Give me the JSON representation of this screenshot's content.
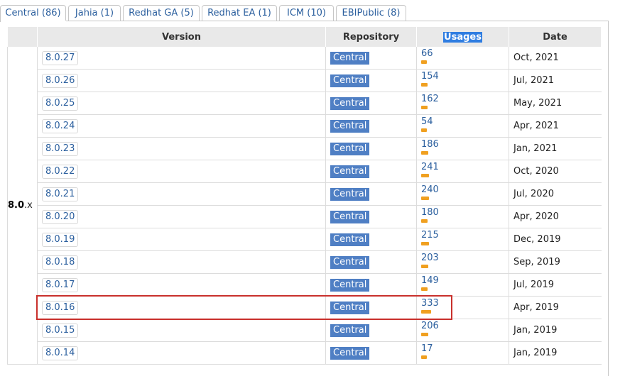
{
  "tabs": [
    {
      "label": "Central (86)",
      "active": true
    },
    {
      "label": "Jahia (1)",
      "active": false
    },
    {
      "label": "Redhat GA (5)",
      "active": false
    },
    {
      "label": "Redhat EA (1)",
      "active": false
    },
    {
      "label": "ICM (10)",
      "active": false
    },
    {
      "label": "EBIPublic (8)",
      "active": false
    }
  ],
  "table": {
    "headers": {
      "version": "Version",
      "repository": "Repository",
      "usages": "Usages",
      "date": "Date"
    },
    "group_label_bold": "8.0",
    "group_label_rest": ".x",
    "rows": [
      {
        "version": "8.0.27",
        "repository": "Central",
        "usages": "66",
        "usage_fraction": 0.2,
        "date": "Oct, 2021"
      },
      {
        "version": "8.0.26",
        "repository": "Central",
        "usages": "154",
        "usage_fraction": 0.46,
        "date": "Jul, 2021"
      },
      {
        "version": "8.0.25",
        "repository": "Central",
        "usages": "162",
        "usage_fraction": 0.49,
        "date": "May, 2021"
      },
      {
        "version": "8.0.24",
        "repository": "Central",
        "usages": "54",
        "usage_fraction": 0.16,
        "date": "Apr, 2021"
      },
      {
        "version": "8.0.23",
        "repository": "Central",
        "usages": "186",
        "usage_fraction": 0.56,
        "date": "Jan, 2021"
      },
      {
        "version": "8.0.22",
        "repository": "Central",
        "usages": "241",
        "usage_fraction": 0.72,
        "date": "Oct, 2020"
      },
      {
        "version": "8.0.21",
        "repository": "Central",
        "usages": "240",
        "usage_fraction": 0.72,
        "date": "Jul, 2020"
      },
      {
        "version": "8.0.20",
        "repository": "Central",
        "usages": "180",
        "usage_fraction": 0.54,
        "date": "Apr, 2020"
      },
      {
        "version": "8.0.19",
        "repository": "Central",
        "usages": "215",
        "usage_fraction": 0.65,
        "date": "Dec, 2019"
      },
      {
        "version": "8.0.18",
        "repository": "Central",
        "usages": "203",
        "usage_fraction": 0.61,
        "date": "Sep, 2019"
      },
      {
        "version": "8.0.17",
        "repository": "Central",
        "usages": "149",
        "usage_fraction": 0.45,
        "date": "Jul, 2019"
      },
      {
        "version": "8.0.16",
        "repository": "Central",
        "usages": "333",
        "usage_fraction": 1.0,
        "date": "Apr, 2019",
        "highlighted": true
      },
      {
        "version": "8.0.15",
        "repository": "Central",
        "usages": "206",
        "usage_fraction": 0.62,
        "date": "Jan, 2019"
      },
      {
        "version": "8.0.14",
        "repository": "Central",
        "usages": "17",
        "usage_fraction": 0.05,
        "date": "Jan, 2019"
      }
    ]
  },
  "colors": {
    "link": "#2b5f9e",
    "repo_badge": "#4f7fc4",
    "usage_bar": "#f0a020",
    "highlight_box": "#c9302c"
  }
}
